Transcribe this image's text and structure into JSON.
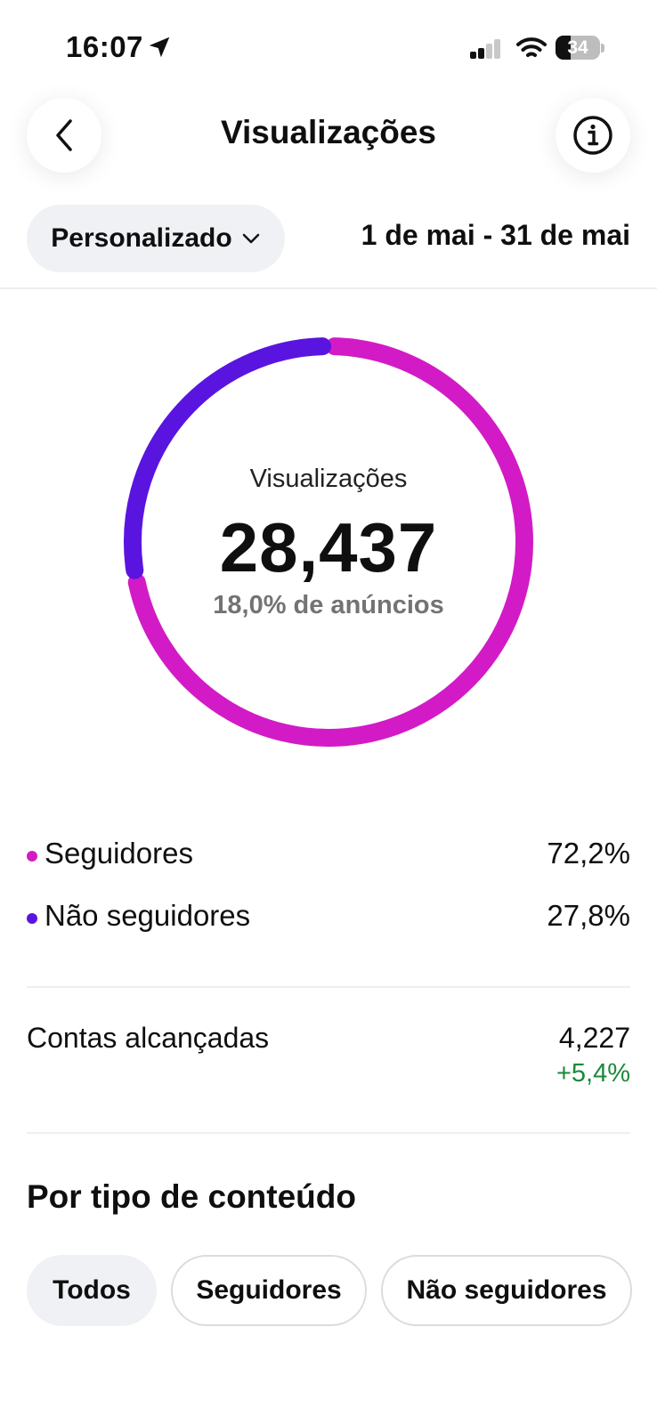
{
  "status_bar": {
    "time": "16:07",
    "battery": "34"
  },
  "header": {
    "title": "Visualizações"
  },
  "filter": {
    "period": "Personalizado",
    "date_range": "1 de mai - 31 de mai"
  },
  "summary": {
    "label": "Visualizações",
    "total": "28,437",
    "ads_share": "18,0% de anúncios"
  },
  "legend": [
    {
      "label": "Seguidores",
      "value": "72,2%",
      "color": "#d21bc6"
    },
    {
      "label": "Não seguidores",
      "value": "27,8%",
      "color": "#5a14e0"
    }
  ],
  "reach": {
    "label": "Contas alcançadas",
    "value": "4,227",
    "change": "+5,4%"
  },
  "content_type": {
    "title": "Por tipo de conteúdo",
    "chips": [
      "Todos",
      "Seguidores",
      "Não seguidores"
    ]
  },
  "chart_data": {
    "type": "pie",
    "variant": "donut",
    "categories": [
      "Seguidores",
      "Não seguidores"
    ],
    "values": [
      72.2,
      27.8
    ],
    "colors": [
      "#d21bc6",
      "#5a14e0"
    ]
  }
}
